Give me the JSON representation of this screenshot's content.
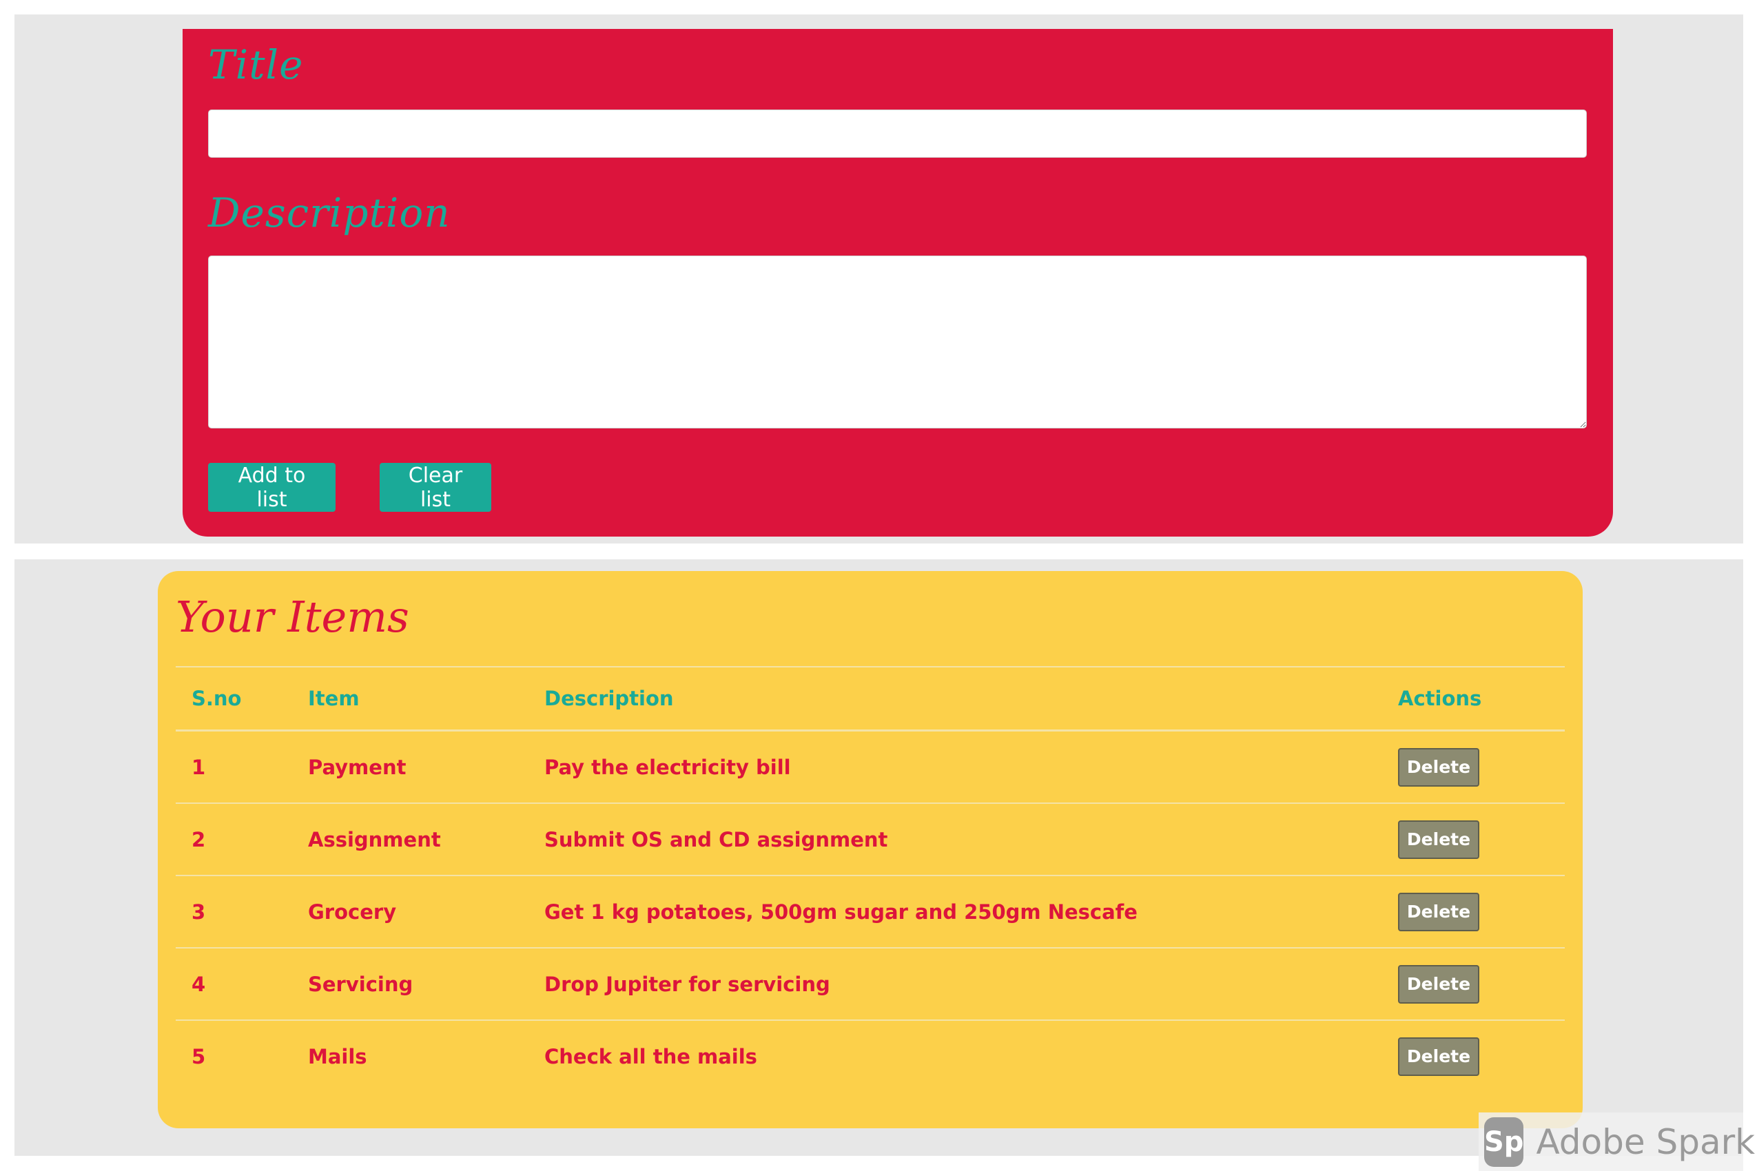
{
  "form": {
    "title_label": "Title",
    "title_value": "",
    "description_label": "Description",
    "description_value": "",
    "add_button": "Add to list",
    "clear_button": "Clear list"
  },
  "list": {
    "heading": "Your Items",
    "columns": [
      "S.no",
      "Item",
      "Description",
      "Actions"
    ],
    "rows": [
      {
        "sno": "1",
        "item": "Payment",
        "description": "Pay the electricity bill",
        "action": "Delete"
      },
      {
        "sno": "2",
        "item": "Assignment",
        "description": "Submit OS and CD assignment",
        "action": "Delete"
      },
      {
        "sno": "3",
        "item": "Grocery",
        "description": "Get 1 kg potatoes, 500gm sugar and 250gm Nescafe",
        "action": "Delete"
      },
      {
        "sno": "4",
        "item": "Servicing",
        "description": "Drop Jupiter for servicing",
        "action": "Delete"
      },
      {
        "sno": "5",
        "item": "Mails",
        "description": "Check all the mails",
        "action": "Delete"
      }
    ]
  },
  "watermark": {
    "logo": "Sp",
    "text": "Adobe Spark"
  },
  "colors": {
    "form_bg": "#dc143c",
    "list_bg": "#fcd04a",
    "accent_teal": "#1aaa98",
    "delete_btn": "#8c8b71",
    "panel_bg": "#e7e7e7"
  }
}
